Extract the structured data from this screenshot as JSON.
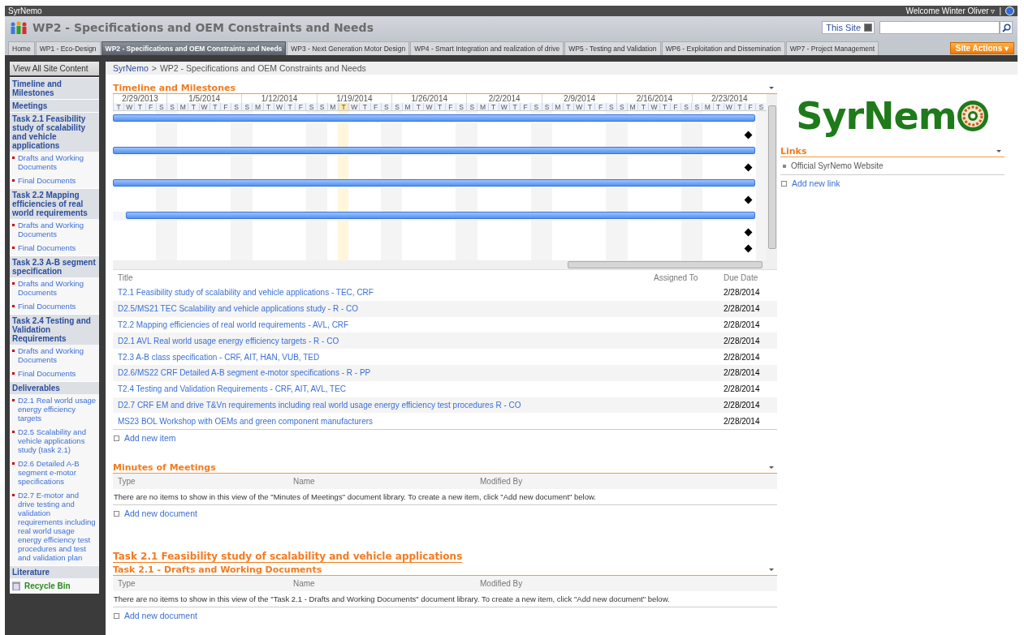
{
  "global_bar": {
    "site": "SyrNemo",
    "welcome": "Welcome Winter Oliver",
    "caret": "▿",
    "separator": "|"
  },
  "header": {
    "title": "WP2 - Specifications and OEM Constraints and Needs",
    "search_scope": "This Site"
  },
  "tabs": [
    {
      "label": "Home",
      "selected": false
    },
    {
      "label": "WP1 - Eco-Design",
      "selected": false
    },
    {
      "label": "WP2 - Specifications and OEM Constraints and Needs",
      "selected": true
    },
    {
      "label": "WP3 - Next Generation Motor Design",
      "selected": false
    },
    {
      "label": "WP4 - Smart Integration and realization of drive",
      "selected": false
    },
    {
      "label": "WP5 - Testing and Validation",
      "selected": false
    },
    {
      "label": "WP6 - Exploitation and Dissemination",
      "selected": false
    },
    {
      "label": "WP7 - Project Management",
      "selected": false
    }
  ],
  "site_actions": {
    "label": "Site Actions",
    "caret": "▾"
  },
  "sidebar": {
    "view_all": "View All Site Content",
    "sections": [
      {
        "title": "Timeline and Milestones"
      },
      {
        "title": "Meetings"
      },
      {
        "title": "Task 2.1 Feasibility study of scalability and vehicle applications",
        "items": [
          "Drafts and Working Documents",
          "Final Documents"
        ]
      },
      {
        "title": "Task 2.2 Mapping efficiencies of real world requirements",
        "items": [
          "Drafts and Working Documents",
          "Final Documents"
        ]
      },
      {
        "title": "Task 2.3 A-B segment specification",
        "items": [
          "Drafts and Working Documents",
          "Final Documents"
        ]
      },
      {
        "title": "Task 2.4 Testing and Validation Requirements",
        "items": [
          "Drafts and Working Documents",
          "Final Documents"
        ]
      },
      {
        "title": "Deliverables",
        "items": [
          "D2.1 Real world usage energy efficiency targets",
          "D2.5 Scalability and vehicle applications study (task 2.1)",
          "D2.6 Detailed A-B segment e-motor specifications",
          "D2.7 E-motor and drive testing and validation requirements including real world usage energy efficiency test procedures and test and validation plan"
        ]
      },
      {
        "title": "Literature"
      }
    ],
    "recycle_bin": "Recycle Bin"
  },
  "breadcrumb": {
    "root": "SyrNemo",
    "separator": ">",
    "current": "WP2 - Specifications and OEM Constraints and Needs"
  },
  "timeline": {
    "title": "Timeline and Milestones",
    "weeks": [
      {
        "label": "2/29/2013",
        "days": [
          {
            "d": "T",
            "today": false
          },
          {
            "d": "W",
            "today": false
          },
          {
            "d": "T",
            "today": false
          },
          {
            "d": "F",
            "today": false
          },
          {
            "d": "S",
            "today": false
          }
        ]
      },
      {
        "label": "1/5/2014",
        "days": [
          {
            "d": "S",
            "today": false
          },
          {
            "d": "M",
            "today": false
          },
          {
            "d": "T",
            "today": false
          },
          {
            "d": "W",
            "today": false
          },
          {
            "d": "T",
            "today": false
          },
          {
            "d": "F",
            "today": false
          },
          {
            "d": "S",
            "today": false
          }
        ]
      },
      {
        "label": "1/12/2014",
        "days": [
          {
            "d": "S",
            "today": false
          },
          {
            "d": "M",
            "today": false
          },
          {
            "d": "T",
            "today": false
          },
          {
            "d": "W",
            "today": false
          },
          {
            "d": "T",
            "today": false
          },
          {
            "d": "F",
            "today": false
          },
          {
            "d": "S",
            "today": false
          }
        ]
      },
      {
        "label": "1/19/2014",
        "days": [
          {
            "d": "S",
            "today": false
          },
          {
            "d": "M",
            "today": false
          },
          {
            "d": "T",
            "today": true
          },
          {
            "d": "W",
            "today": false
          },
          {
            "d": "T",
            "today": false
          },
          {
            "d": "F",
            "today": false
          },
          {
            "d": "S",
            "today": false
          }
        ]
      },
      {
        "label": "1/26/2014",
        "days": [
          {
            "d": "S",
            "today": false
          },
          {
            "d": "M",
            "today": false
          },
          {
            "d": "T",
            "today": false
          },
          {
            "d": "W",
            "today": false
          },
          {
            "d": "T",
            "today": false
          },
          {
            "d": "F",
            "today": false
          },
          {
            "d": "S",
            "today": false
          }
        ]
      },
      {
        "label": "2/2/2014",
        "days": [
          {
            "d": "S",
            "today": false
          },
          {
            "d": "M",
            "today": false
          },
          {
            "d": "T",
            "today": false
          },
          {
            "d": "W",
            "today": false
          },
          {
            "d": "T",
            "today": false
          },
          {
            "d": "F",
            "today": false
          },
          {
            "d": "S",
            "today": false
          }
        ]
      },
      {
        "label": "2/9/2014",
        "days": [
          {
            "d": "S",
            "today": false
          },
          {
            "d": "M",
            "today": false
          },
          {
            "d": "T",
            "today": false
          },
          {
            "d": "W",
            "today": false
          },
          {
            "d": "T",
            "today": false
          },
          {
            "d": "F",
            "today": false
          },
          {
            "d": "S",
            "today": false
          }
        ]
      },
      {
        "label": "2/16/2014",
        "days": [
          {
            "d": "S",
            "today": false
          },
          {
            "d": "M",
            "today": false
          },
          {
            "d": "T",
            "today": false
          },
          {
            "d": "W",
            "today": false
          },
          {
            "d": "T",
            "today": false
          },
          {
            "d": "F",
            "today": false
          },
          {
            "d": "S",
            "today": false
          }
        ]
      },
      {
        "label": "2/23/2014",
        "days": [
          {
            "d": "S",
            "today": false
          },
          {
            "d": "M",
            "today": false
          },
          {
            "d": "T",
            "today": false
          },
          {
            "d": "W",
            "today": false
          },
          {
            "d": "T",
            "today": false
          },
          {
            "d": "F",
            "today": false
          },
          {
            "d": "S",
            "today": false
          }
        ]
      }
    ],
    "rows": [
      {
        "kind": "bar",
        "level": 1
      },
      {
        "kind": "milestone"
      },
      {
        "kind": "bar",
        "level": 1
      },
      {
        "kind": "milestone"
      },
      {
        "kind": "bar",
        "level": 1
      },
      {
        "kind": "milestone"
      },
      {
        "kind": "bar",
        "level": 0.98
      },
      {
        "kind": "milestone"
      },
      {
        "kind": "milestone"
      }
    ],
    "columns": [
      "Title",
      "Assigned To",
      "Due Date"
    ],
    "items": [
      {
        "title": "T2.1 Feasibility study of scalability and vehicle applications - TEC, CRF",
        "due": "2/28/2014"
      },
      {
        "title": "D2.5/MS21 TEC Scalability and vehicle applications study - R - CO",
        "due": "2/28/2014"
      },
      {
        "title": "T2.2 Mapping efficiencies of real world requirements - AVL, CRF",
        "due": "2/28/2014"
      },
      {
        "title": "D2.1 AVL Real world usage energy efficiency targets - R - CO",
        "due": "2/28/2014"
      },
      {
        "title": "T2.3 A-B class specification - CRF, AIT, HAN, VUB, TED",
        "due": "2/28/2014"
      },
      {
        "title": "D2.6/MS22 CRF Detailed A-B segment e-motor specifications - R - PP",
        "due": "2/28/2014"
      },
      {
        "title": "T2.4 Testing and Validation Requirements - CRF, AIT, AVL, TEC",
        "due": "2/28/2014"
      },
      {
        "title": "D2.7 CRF EM and drive T&Vn requirements including real world usage energy efficiency test procedures R - CO",
        "due": "2/28/2014"
      },
      {
        "title": "MS23 BOL Workshop with OEMs and green component manufacturers",
        "due": "2/28/2014"
      }
    ],
    "add": "Add new item"
  },
  "libraries": [
    {
      "title": "Minutes of Meetings",
      "columns": [
        "Type",
        "Name",
        "Modified By"
      ],
      "message": "There are no items to show in this view of the \"Minutes of Meetings\" document library. To create a new item, click \"Add new document\" below.",
      "add": "Add new document"
    },
    {
      "group_title": "Task 2.1 Feasibility study of scalability and vehicle applications",
      "title": "Task 2.1 - Drafts and Working Documents",
      "columns": [
        "Type",
        "Name",
        "Modified By"
      ],
      "message": "There are no items to show in this view of the \"Task 2.1 - Drafts and Working Documents\" document library. To create a new item, click \"Add new document\" below.",
      "add": "Add new document"
    }
  ],
  "logo": {
    "text": "SyrNem"
  },
  "links": {
    "title": "Links",
    "items": [
      "Official SyrNemo Website"
    ],
    "add": "Add new link"
  }
}
